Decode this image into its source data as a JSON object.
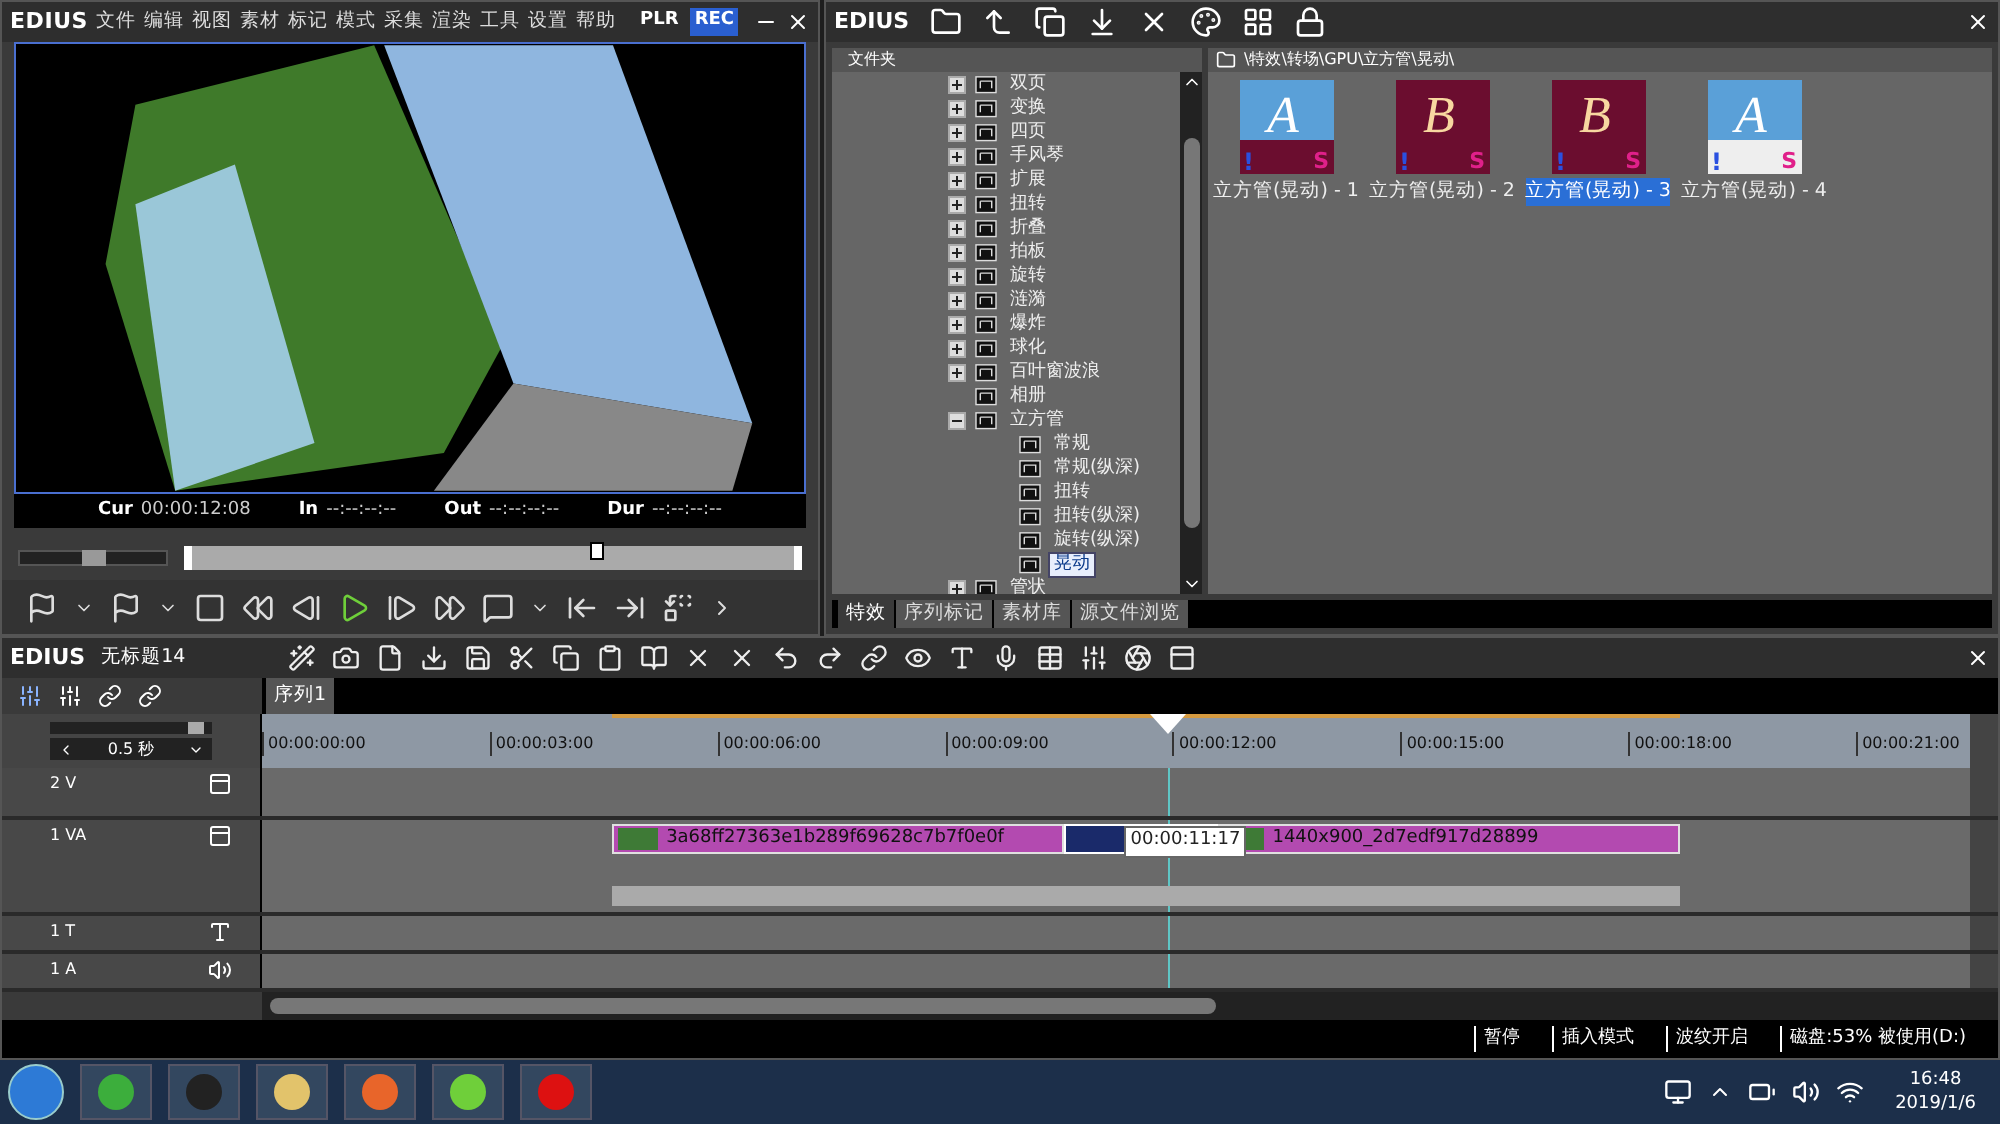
{
  "player": {
    "app": "EDIUS",
    "menu": [
      "文件",
      "编辑",
      "视图",
      "素材",
      "标记",
      "模式",
      "采集",
      "渲染",
      "工具",
      "设置",
      "帮助"
    ],
    "modes": [
      {
        "label": "PLR",
        "selected": false
      },
      {
        "label": "REC",
        "selected": true
      }
    ],
    "timecodes": [
      {
        "label": "Cur",
        "value": "00:00:12:08"
      },
      {
        "label": "In",
        "value": "--:--:--:--"
      },
      {
        "label": "Out",
        "value": "--:--:--:--"
      },
      {
        "label": "Dur",
        "value": "--:--:--:--"
      }
    ],
    "shuttle": {
      "level": 0.5
    },
    "position": {
      "level": 0.67
    }
  },
  "bin": {
    "app": "EDIUS",
    "folder_header": "文件夹",
    "path": "\\特效\\转场\\GPU\\立方管\\晃动\\",
    "tree": [
      {
        "label": "双页",
        "kind": "group",
        "expanded": false,
        "selected": false
      },
      {
        "label": "变换",
        "kind": "group",
        "expanded": false,
        "selected": false
      },
      {
        "label": "四页",
        "kind": "group",
        "expanded": false,
        "selected": false
      },
      {
        "label": "手风琴",
        "kind": "group",
        "expanded": false,
        "selected": false
      },
      {
        "label": "扩展",
        "kind": "group",
        "expanded": false,
        "selected": false
      },
      {
        "label": "扭转",
        "kind": "group",
        "expanded": false,
        "selected": false
      },
      {
        "label": "折叠",
        "kind": "group",
        "expanded": false,
        "selected": false
      },
      {
        "label": "拍板",
        "kind": "group",
        "expanded": false,
        "selected": false
      },
      {
        "label": "旋转",
        "kind": "group",
        "expanded": false,
        "selected": false
      },
      {
        "label": "涟漪",
        "kind": "group",
        "expanded": false,
        "selected": false
      },
      {
        "label": "爆炸",
        "kind": "group",
        "expanded": false,
        "selected": false
      },
      {
        "label": "球化",
        "kind": "group",
        "expanded": false,
        "selected": false
      },
      {
        "label": "百叶窗波浪",
        "kind": "group",
        "expanded": false,
        "selected": false
      },
      {
        "label": "相册",
        "kind": "effect",
        "selected": false
      },
      {
        "label": "立方管",
        "kind": "group",
        "expanded": true,
        "selected": false,
        "children": [
          {
            "label": "常规",
            "kind": "effect",
            "selected": false
          },
          {
            "label": "常规(纵深)",
            "kind": "effect",
            "selected": false
          },
          {
            "label": "扭转",
            "kind": "effect",
            "selected": false
          },
          {
            "label": "扭转(纵深)",
            "kind": "effect",
            "selected": false
          },
          {
            "label": "旋转(纵深)",
            "kind": "effect",
            "selected": false
          },
          {
            "label": "晃动",
            "kind": "effect",
            "selected": true
          }
        ]
      },
      {
        "label": "管状",
        "kind": "group",
        "expanded": false,
        "selected": false
      }
    ],
    "tabs": [
      {
        "label": "特效",
        "selected": true
      },
      {
        "label": "序列标记",
        "selected": false
      },
      {
        "label": "素材库",
        "selected": false
      },
      {
        "label": "源文件浏览",
        "selected": false
      }
    ],
    "thumbnails": [
      {
        "label": "立方管(晃动) - 1",
        "letter": "A",
        "mark_left": "!",
        "mark_right": "S",
        "selected": false
      },
      {
        "label": "立方管(晃动) - 2",
        "letter": "B",
        "mark_left": "!",
        "mark_right": "S",
        "selected": false
      },
      {
        "label": "立方管(晃动) - 3",
        "letter": "B",
        "mark_left": "!",
        "mark_right": "S",
        "selected": true
      },
      {
        "label": "立方管(晃动) - 4",
        "letter": "A",
        "mark_left": "!",
        "mark_right": "S",
        "selected": false
      }
    ]
  },
  "timeline": {
    "app": "EDIUS",
    "project": "无标题14",
    "sequence_tabs": [
      {
        "label": "序列1",
        "selected": true
      }
    ],
    "scale": "0.5 秒",
    "zoom": {
      "level": 0.9
    },
    "ruler": [
      "00:00:00:00",
      "00:00:03:00",
      "00:00:06:00",
      "00:00:09:00",
      "00:00:12:00",
      "00:00:15:00",
      "00:00:18:00",
      "00:00:21:00"
    ],
    "playhead": {
      "level": 0.53
    },
    "tracks": [
      {
        "name": "2 V",
        "kind": "video"
      },
      {
        "name": "1 VA",
        "kind": "videoaudio"
      },
      {
        "name": "1 T",
        "kind": "title"
      },
      {
        "name": "1 A",
        "kind": "audio"
      }
    ],
    "clips": [
      {
        "name": "3a68ff27363e1b289f69628c7b7f0e0f"
      },
      {
        "name": "1440x900_2d7edf917d28899"
      }
    ],
    "tooltip": "00:00:11:17"
  },
  "status_bar": [
    "暂停",
    "插入模式",
    "波纹开启",
    "磁盘:53% 被使用(D:)"
  ],
  "taskbar": {
    "time": "16:48",
    "date": "2019/1/6"
  }
}
